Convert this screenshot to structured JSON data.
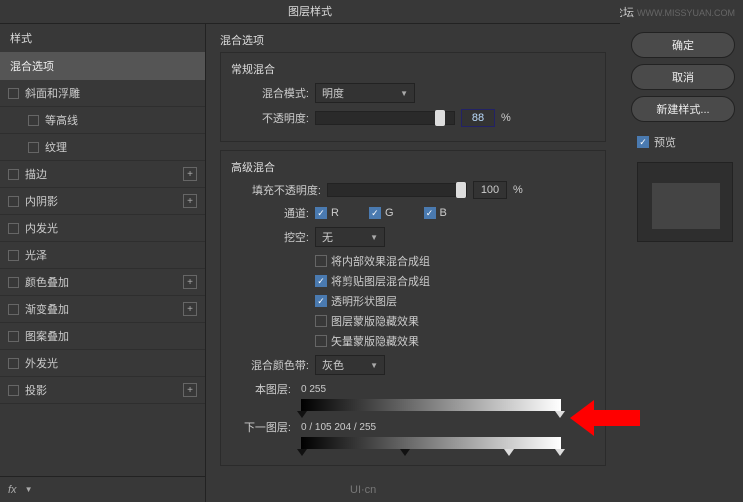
{
  "watermark": {
    "text": "思缘设计论坛",
    "sub": "WWW.MISSYUAN.COM"
  },
  "title": "图层样式",
  "sidebar": {
    "header": "样式",
    "selected": "混合选项",
    "items": [
      {
        "label": "斜面和浮雕",
        "plus": false,
        "indent": 0
      },
      {
        "label": "等高线",
        "plus": false,
        "indent": 1
      },
      {
        "label": "纹理",
        "plus": false,
        "indent": 1
      },
      {
        "label": "描边",
        "plus": true,
        "indent": 0
      },
      {
        "label": "内阴影",
        "plus": true,
        "indent": 0
      },
      {
        "label": "内发光",
        "plus": false,
        "indent": 0
      },
      {
        "label": "光泽",
        "plus": false,
        "indent": 0
      },
      {
        "label": "颜色叠加",
        "plus": true,
        "indent": 0
      },
      {
        "label": "渐变叠加",
        "plus": true,
        "indent": 0
      },
      {
        "label": "图案叠加",
        "plus": false,
        "indent": 0
      },
      {
        "label": "外发光",
        "plus": false,
        "indent": 0
      },
      {
        "label": "投影",
        "plus": true,
        "indent": 0
      }
    ],
    "fx": "fx"
  },
  "content": {
    "section": "混合选项",
    "normal": {
      "title": "常规混合",
      "modeLabel": "混合模式:",
      "modeValue": "明度",
      "opacityLabel": "不透明度:",
      "opacityValue": "88",
      "pct": "%"
    },
    "adv": {
      "title": "高级混合",
      "fillLabel": "填充不透明度:",
      "fillValue": "100",
      "pct": "%",
      "channelLabel": "通道:",
      "r": "R",
      "g": "G",
      "b": "B",
      "knockLabel": "挖空:",
      "knockValue": "无",
      "opts": [
        {
          "on": false,
          "label": "将内部效果混合成组"
        },
        {
          "on": true,
          "label": "将剪贴图层混合成组"
        },
        {
          "on": true,
          "label": "透明形状图层"
        },
        {
          "on": false,
          "label": "图层蒙版隐藏效果"
        },
        {
          "on": false,
          "label": "矢量蒙版隐藏效果"
        }
      ]
    },
    "blendif": {
      "label": "混合颜色带:",
      "value": "灰色",
      "thisLabel": "本图层:",
      "thisVals": "0          255",
      "underLabel": "下一图层:",
      "underVals": "0  /  105     204  /  255"
    }
  },
  "rpanel": {
    "ok": "确定",
    "cancel": "取消",
    "newstyle": "新建样式...",
    "preview": "预览"
  },
  "logo": "UI·cn"
}
